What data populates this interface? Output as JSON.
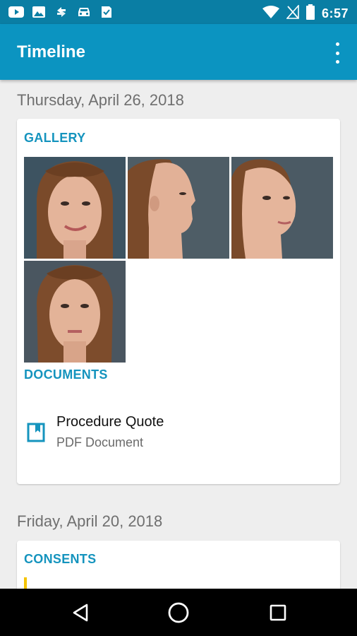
{
  "status_bar": {
    "time": "6:57",
    "left_icons": [
      "youtube-icon",
      "image-icon",
      "sync-icon",
      "car-icon",
      "check-doc-icon"
    ],
    "right_icons": [
      "wifi-icon",
      "no-signal-icon",
      "battery-icon"
    ]
  },
  "app_bar": {
    "title": "Timeline",
    "menu_icon": "overflow-menu-icon"
  },
  "timeline": [
    {
      "date": "Thursday, April 26, 2018",
      "sections": [
        {
          "title": "GALLERY",
          "photos": [
            "front-view-photo",
            "right-profile-photo",
            "three-quarter-photo",
            "neutral-front-photo"
          ]
        },
        {
          "title": "DOCUMENTS",
          "documents": [
            {
              "icon": "bookmark-doc-icon",
              "title": "Procedure Quote",
              "subtitle": "PDF Document"
            }
          ]
        }
      ]
    },
    {
      "date": "Friday, April 20, 2018",
      "sections": [
        {
          "title": "CONSENTS"
        }
      ]
    }
  ],
  "nav_bar": {
    "buttons": [
      "back-icon",
      "home-icon",
      "recents-icon"
    ]
  },
  "colors": {
    "status_bar": "#0a7ea4",
    "app_bar": "#0b94c1",
    "section_title": "#1594be",
    "background": "#eeeeee",
    "accent_yellow": "#f5c400"
  }
}
